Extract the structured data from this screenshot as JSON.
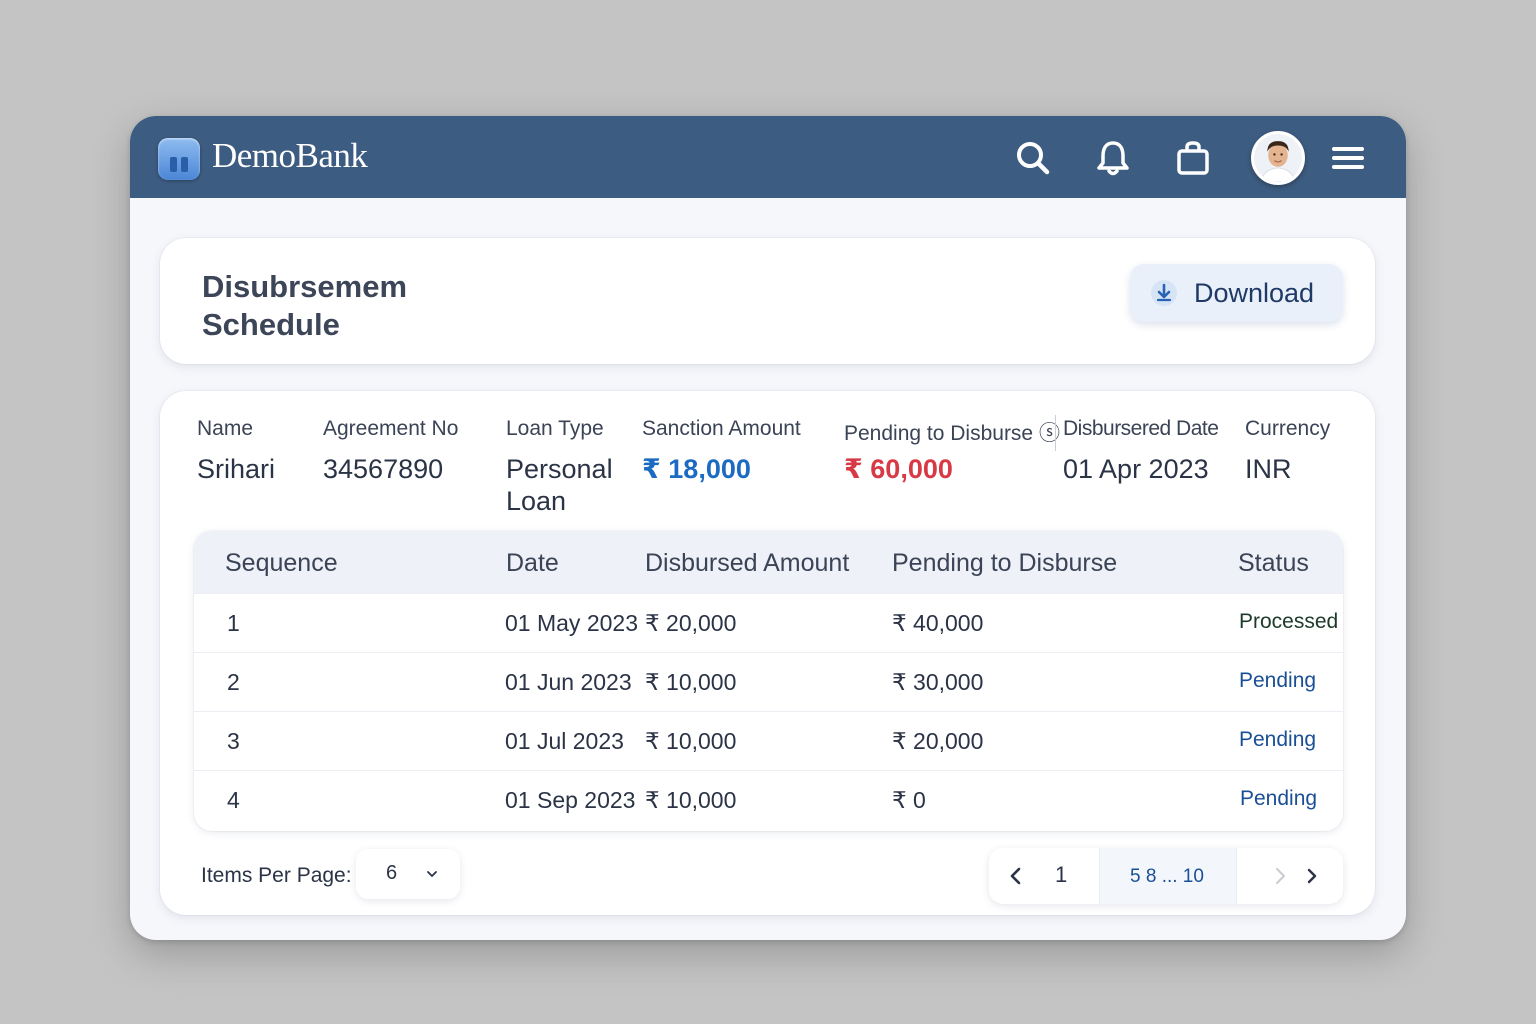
{
  "app": {
    "brand": "DemoBank"
  },
  "topbar": {
    "icons": [
      "search-icon",
      "bell-icon",
      "shopping-bag-icon",
      "avatar",
      "menu-icon"
    ]
  },
  "page": {
    "title": "Disubrsemem Schedule",
    "download_label": "Download"
  },
  "info": {
    "name_label": "Name",
    "name_value": "Srihari",
    "agreement_label": "Agreement No",
    "agreement_value": "34567890",
    "loan_type_label": "Loan Type",
    "loan_type_value": "Personal Loan",
    "sanction_label": "Sanction Amount",
    "sanction_value": "₹ 18,000",
    "pending_label": "Pending to Disburse ⓢ",
    "pending_value": "₹ 60,000",
    "disbursed_date_label": "Disbursered Date",
    "disbursed_date_value": "01 Apr 2023",
    "currency_label": "Currency",
    "currency_value": "INR"
  },
  "table": {
    "columns": [
      "Sequence",
      "Date",
      "Disbursed Amount",
      "Pending to Disburse",
      "Status"
    ],
    "rows": [
      {
        "seq": "1",
        "date": "01 May 2023",
        "disbursed": "₹ 20,000",
        "pending": "₹ 40,000",
        "status": "Processed"
      },
      {
        "seq": "2",
        "date": "01 Jun 2023",
        "disbursed": "₹ 10,000",
        "pending": "₹ 30,000",
        "status": "Pending"
      },
      {
        "seq": "3",
        "date": "01 Jul 2023",
        "disbursed": "₹ 10,000",
        "pending": "₹ 20,000",
        "status": "Pending"
      },
      {
        "seq": "4",
        "date": "01 Sep 2023",
        "disbursed": "₹ 10,000",
        "pending": "₹ 0",
        "status": "Pending"
      }
    ]
  },
  "footer": {
    "items_per_page_label": "Items Per Page:",
    "items_per_page_value": "6",
    "current_page": "1",
    "page_range": "5  8 ... 10"
  },
  "colors": {
    "topbar": "#3d5c81",
    "sanction": "#1c6bc2",
    "pending": "#d83a45",
    "status_pending": "#1a4f96"
  }
}
